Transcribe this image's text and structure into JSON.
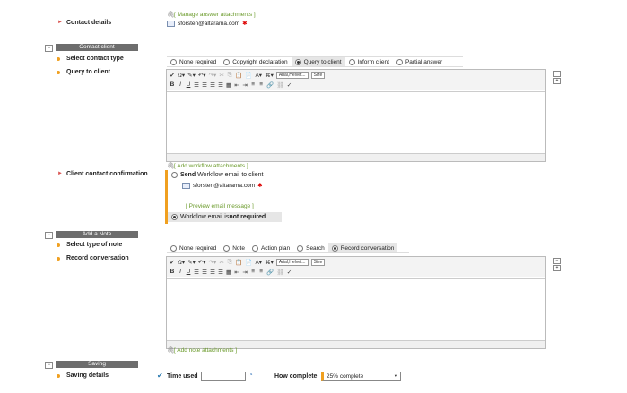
{
  "contact_details": {
    "label": "Contact details",
    "manage_link": "[ Manage answer attachments ]",
    "email": "sforsten@altarama.com"
  },
  "contact_client": {
    "section_title": "Contact client",
    "contact_type_label": "Select contact type",
    "contact_type_options": [
      "None required",
      "Copyright declaration",
      "Query to client",
      "Inform client",
      "Partial answer"
    ],
    "contact_type_selected": "Query to client",
    "query_label": "Query to client",
    "confirmation_label": "Client contact confirmation",
    "add_workflow_link": "[ Add workflow attachments ]",
    "send_bold": "Send",
    "send_rest": "Workflow email to client",
    "confirm_email": "sforsten@altarama.com",
    "preview_link": "[ Preview email message ]",
    "not_required_prefix": "Workflow email is ",
    "not_required_bold": "not required"
  },
  "add_note": {
    "section_title": "Add a Note",
    "note_type_label": "Select type of note",
    "note_type_options": [
      "None required",
      "Note",
      "Action plan",
      "Search",
      "Record conversation"
    ],
    "note_type_selected": "Record conversation",
    "record_label": "Record conversation",
    "add_note_link": "[ Add note attachments ]"
  },
  "saving": {
    "section_title": "Saving",
    "details_label": "Saving details",
    "time_used_label": "Time used",
    "how_complete_label": "How complete",
    "how_complete_value": "25% complete"
  },
  "editor": {
    "font_select": "Arial,Helvet...",
    "size_select": "Size"
  },
  "colors": {
    "section_bar": "#6d6d6d",
    "link_green": "#6a9a2a",
    "bullet_orange": "#f0a020",
    "arrow_red": "#d9534f"
  }
}
